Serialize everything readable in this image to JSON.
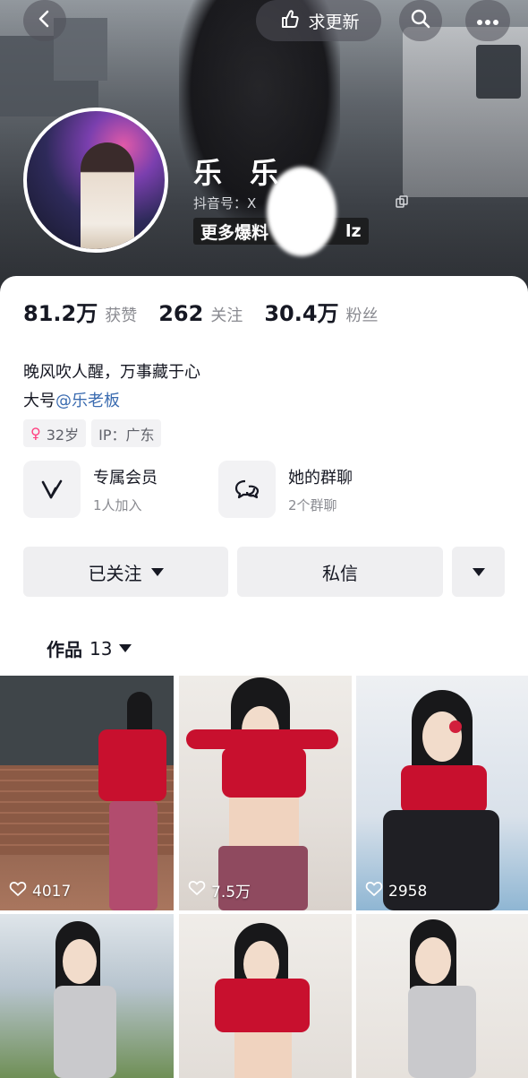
{
  "header": {
    "update_label": "求更新",
    "nickname": "乐 乐",
    "douyin_id": "抖音号：X",
    "more_tag": "更多爆料",
    "more_tag_suffix": "lz"
  },
  "stats": [
    {
      "value": "81.2万",
      "label": "获赞"
    },
    {
      "value": "262",
      "label": "关注"
    },
    {
      "value": "30.4万",
      "label": "粉丝"
    }
  ],
  "bio": {
    "line1": "晚风吹人醒，万事藏于心",
    "line2_prefix": "大号",
    "line2_mention": "@乐老板"
  },
  "tags": {
    "age": "32岁",
    "ip": "IP：广东"
  },
  "features": {
    "member": {
      "title": "专属会员",
      "sub": "1人加入"
    },
    "group": {
      "title": "她的群聊",
      "sub": "2个群聊"
    }
  },
  "buttons": {
    "follow": "已关注",
    "dm": "私信"
  },
  "works": {
    "label": "作品",
    "count": "13"
  },
  "videos": [
    {
      "likes": "4017"
    },
    {
      "likes": "7.5万"
    },
    {
      "likes": "2958"
    }
  ],
  "colors": {
    "accent_link": "#3a6bb0",
    "female_pink": "#ff3e7f",
    "button_bg": "#efeff1"
  }
}
